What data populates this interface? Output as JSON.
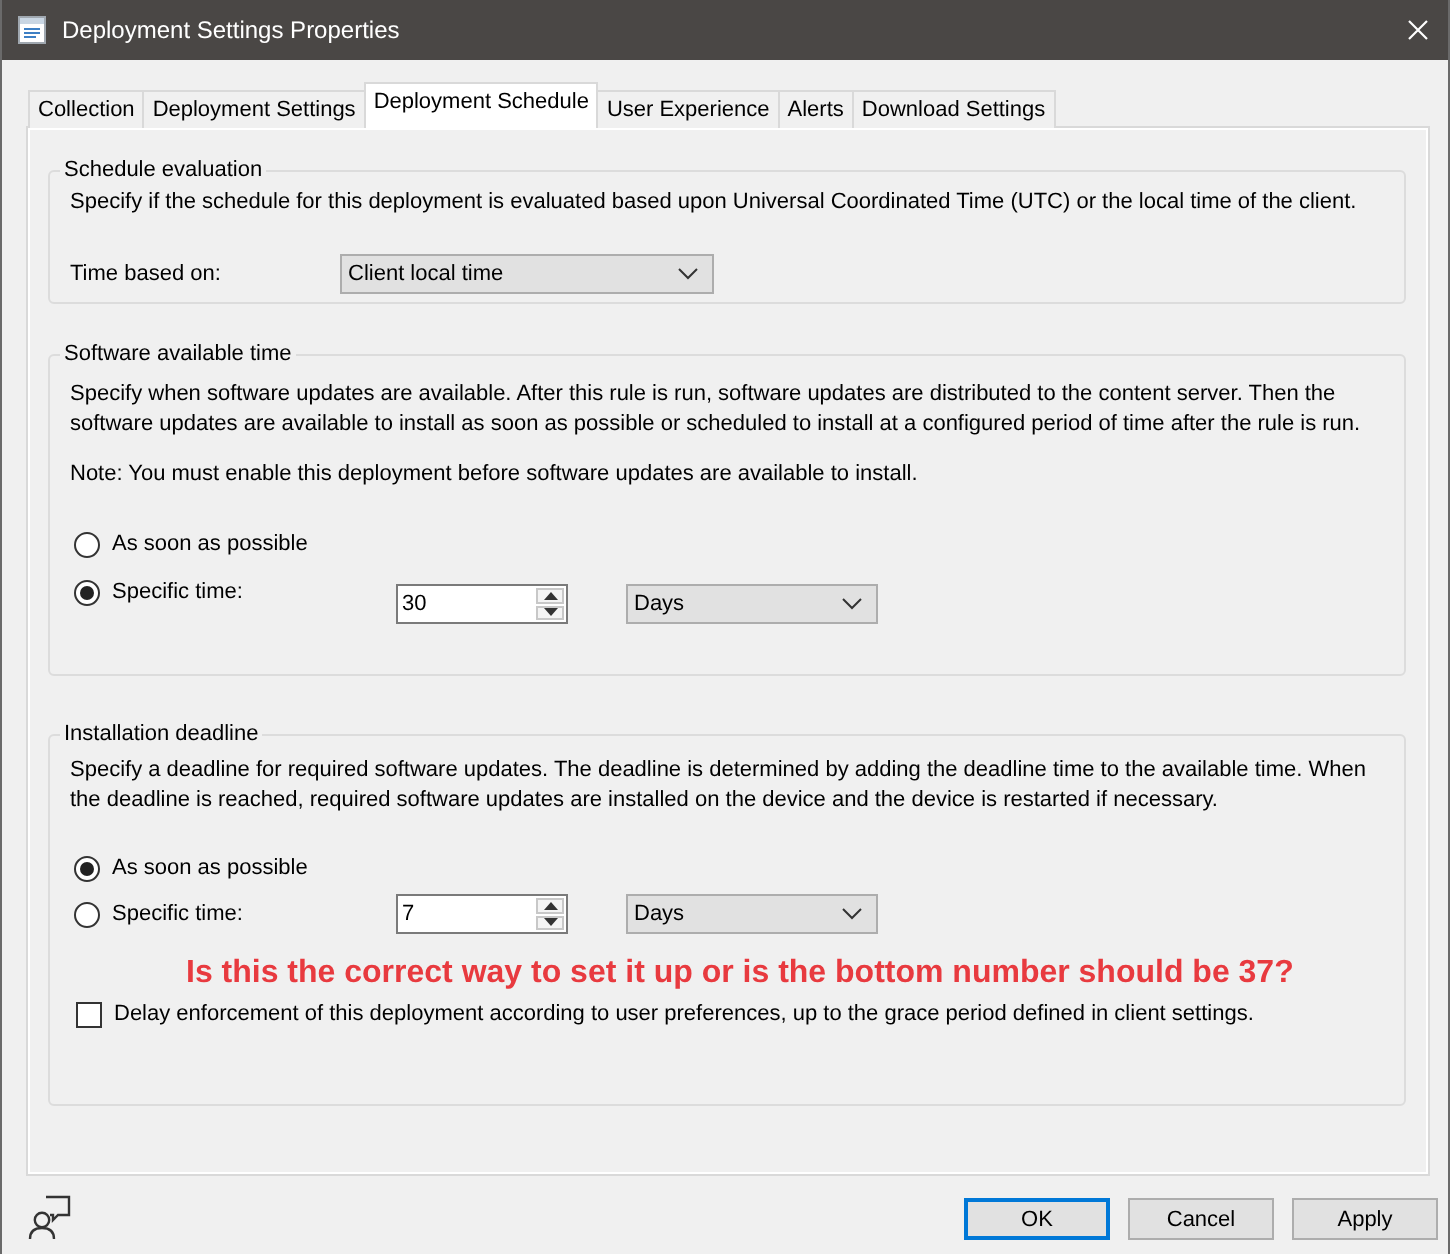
{
  "window": {
    "title": "Deployment Settings Properties"
  },
  "tabs": [
    {
      "label": "Collection",
      "selected": false
    },
    {
      "label": "Deployment Settings",
      "selected": false
    },
    {
      "label": "Deployment Schedule",
      "selected": true
    },
    {
      "label": "User Experience",
      "selected": false
    },
    {
      "label": "Alerts",
      "selected": false
    },
    {
      "label": "Download Settings",
      "selected": false
    }
  ],
  "schedule_evaluation": {
    "title": "Schedule evaluation",
    "description": "Specify if the schedule for this deployment is evaluated based upon Universal Coordinated Time (UTC) or the local time of the client.",
    "time_based_on": {
      "label": "Time based on:",
      "value": "Client local time"
    }
  },
  "software_available_time": {
    "title": "Software available time",
    "description": "Specify when software updates are available. After this rule is run, software updates are distributed to the content server. Then the\nsoftware updates are available to install as soon as possible or scheduled to install at a configured period of time after the rule is run.",
    "note": "Note: You must enable this deployment before software updates are available to install.",
    "options": [
      {
        "label": "As soon as possible",
        "selected": false
      },
      {
        "label": "Specific time:",
        "selected": true,
        "amount": "30",
        "unit": "Days"
      }
    ]
  },
  "installation_deadline": {
    "title": "Installation deadline",
    "description": "Specify a deadline for required software updates. The deadline is determined by adding the deadline time to the available time. When\nthe deadline is reached, required software updates are installed on the device and the device is restarted if necessary.",
    "options": [
      {
        "label": "As soon as possible",
        "selected": true
      },
      {
        "label": "Specific time:",
        "selected": false,
        "amount": "7",
        "unit": "Days"
      }
    ],
    "annotation": "Is this the correct way to set it up or is the bottom number should be 37?",
    "delay_enforcement": {
      "label": "Delay enforcement of this deployment according to user preferences, up to the grace period defined in client settings.",
      "checked": false
    }
  },
  "buttons": [
    {
      "label": "OK",
      "default": true
    },
    {
      "label": "Cancel",
      "default": false
    },
    {
      "label": "Apply",
      "default": false
    }
  ]
}
